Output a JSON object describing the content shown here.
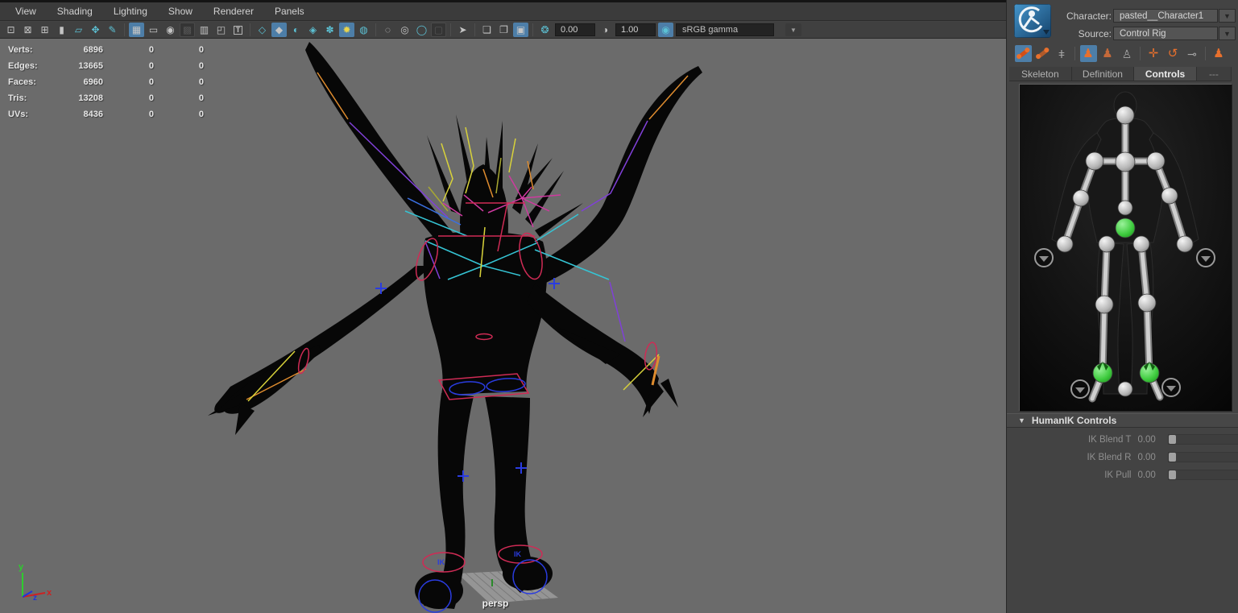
{
  "app": {
    "name": "Maya viewport with HumanIK Controls"
  },
  "menu_bar": {
    "items": [
      "View",
      "Shading",
      "Lighting",
      "Show",
      "Renderer",
      "Panels"
    ]
  },
  "toolbar": {
    "items": [
      {
        "kind": "icon",
        "name": "select-camera-icon",
        "glyph": "⊡",
        "tone": "gray"
      },
      {
        "kind": "icon",
        "name": "lock-camera-icon",
        "glyph": "⊠",
        "tone": "gray"
      },
      {
        "kind": "icon",
        "name": "camera-attributes-icon",
        "glyph": "⊞",
        "tone": "gray"
      },
      {
        "kind": "icon",
        "name": "bookmark-icon",
        "glyph": "▮",
        "tone": "gray"
      },
      {
        "kind": "icon",
        "name": "image-plane-icon",
        "glyph": "▱",
        "tone": "teal"
      },
      {
        "kind": "icon",
        "name": "pan-zoom-icon",
        "glyph": "✥",
        "tone": "teal"
      },
      {
        "kind": "icon",
        "name": "grease-pencil-icon",
        "glyph": "✎",
        "tone": "teal"
      },
      {
        "kind": "sep"
      },
      {
        "kind": "icon",
        "name": "grid-icon",
        "glyph": "▦",
        "tone": "gray",
        "active": true
      },
      {
        "kind": "icon",
        "name": "film-gate-icon",
        "glyph": "▭",
        "tone": "gray"
      },
      {
        "kind": "icon",
        "name": "resolution-gate-icon",
        "glyph": "◉",
        "tone": "gray"
      },
      {
        "kind": "icon",
        "name": "gate-mask-icon",
        "glyph": "▩",
        "tone": "dark"
      },
      {
        "kind": "icon",
        "name": "field-chart-icon",
        "glyph": "▥",
        "tone": "gray"
      },
      {
        "kind": "icon",
        "name": "safe-action-icon",
        "glyph": "◰",
        "tone": "gray"
      },
      {
        "kind": "icon",
        "name": "safe-title-icon",
        "glyph": "T",
        "tone": "gray",
        "boxed": true
      },
      {
        "kind": "sep"
      },
      {
        "kind": "icon",
        "name": "wireframe-icon",
        "glyph": "◇",
        "tone": "teal"
      },
      {
        "kind": "icon",
        "name": "smooth-shade-icon",
        "glyph": "◆",
        "tone": "gray",
        "active": true
      },
      {
        "kind": "icon",
        "name": "textured-icon",
        "glyph": "◐",
        "tone": "teal"
      },
      {
        "kind": "icon",
        "name": "use-default-material-icon",
        "glyph": "◈",
        "tone": "teal"
      },
      {
        "kind": "icon",
        "name": "xray-icon",
        "glyph": "✽",
        "tone": "teal"
      },
      {
        "kind": "icon",
        "name": "lighting-icon",
        "glyph": "✹",
        "tone": "yellow",
        "active": true
      },
      {
        "kind": "icon",
        "name": "shadows-icon",
        "glyph": "◍",
        "tone": "teal"
      },
      {
        "kind": "sep"
      },
      {
        "kind": "icon",
        "name": "occlusion-icon",
        "glyph": "◌",
        "tone": "gray"
      },
      {
        "kind": "icon",
        "name": "motion-blur-icon",
        "glyph": "◎",
        "tone": "gray"
      },
      {
        "kind": "icon",
        "name": "antialias-icon",
        "glyph": "◯",
        "tone": "teal"
      },
      {
        "kind": "icon",
        "name": "depth-of-field-icon",
        "glyph": "▢",
        "tone": "dark"
      },
      {
        "kind": "sep"
      },
      {
        "kind": "icon",
        "name": "isolate-select-icon",
        "glyph": "➤",
        "tone": "gray"
      },
      {
        "kind": "sep"
      },
      {
        "kind": "icon",
        "name": "layer-front-icon",
        "glyph": "❏",
        "tone": "gray"
      },
      {
        "kind": "icon",
        "name": "layer-over-icon",
        "glyph": "❐",
        "tone": "gray"
      },
      {
        "kind": "icon",
        "name": "snapshot-icon",
        "glyph": "▣",
        "tone": "gray",
        "active": true
      },
      {
        "kind": "sep"
      },
      {
        "kind": "icon",
        "name": "exposure-icon",
        "glyph": "❂",
        "tone": "teal"
      },
      {
        "kind": "field",
        "name": "exposure-field",
        "value": "0.00"
      },
      {
        "kind": "icon",
        "name": "contrast-icon",
        "glyph": "◑",
        "tone": "gray"
      },
      {
        "kind": "field",
        "name": "gamma-field",
        "value": "1.00"
      },
      {
        "kind": "icon",
        "name": "color-management-icon",
        "glyph": "◉",
        "tone": "teal",
        "active": true
      },
      {
        "kind": "combo",
        "name": "view-transform-combo",
        "value": "sRGB gamma"
      },
      {
        "kind": "combo_arrow",
        "name": "view-transform-arrow",
        "glyph": "▼"
      }
    ]
  },
  "hud": {
    "rows": [
      {
        "label": "Verts:",
        "c1": "6896",
        "c2": "0",
        "c3": "0"
      },
      {
        "label": "Edges:",
        "c1": "13665",
        "c2": "0",
        "c3": "0"
      },
      {
        "label": "Faces:",
        "c1": "6960",
        "c2": "0",
        "c3": "0"
      },
      {
        "label": "Tris:",
        "c1": "13208",
        "c2": "0",
        "c3": "0"
      },
      {
        "label": "UVs:",
        "c1": "8436",
        "c2": "0",
        "c3": "0"
      }
    ]
  },
  "viewport": {
    "camera_label": "persp",
    "ik_label": "IK",
    "axis": {
      "x": "x",
      "y": "y",
      "z": "z"
    }
  },
  "right_panel": {
    "character_label": "Character:",
    "character_value": "pasted__Character1",
    "source_label": "Source:",
    "source_value": "Control Rig",
    "dropdown_arrow": "▼",
    "icon_bar": [
      {
        "kind": "bone",
        "name": "add-joints-icon",
        "active": true
      },
      {
        "kind": "bone",
        "name": "mirror-joints-icon"
      },
      {
        "kind": "icon",
        "name": "skeleton-icon",
        "glyph": "ǂ",
        "tone": "graylight"
      },
      {
        "kind": "sep"
      },
      {
        "kind": "icon",
        "name": "full-body-mode-icon",
        "glyph": "♟",
        "tone": "orange",
        "active": true
      },
      {
        "kind": "icon",
        "name": "body-part-mode-icon",
        "glyph": "♟",
        "tone": "orange2"
      },
      {
        "kind": "icon",
        "name": "selection-mode-icon",
        "glyph": "♙",
        "tone": "graylight"
      },
      {
        "kind": "sep"
      },
      {
        "kind": "icon",
        "name": "pin-translate-icon",
        "glyph": "✛",
        "tone": "orange"
      },
      {
        "kind": "icon",
        "name": "pin-rotate-icon",
        "glyph": "↺",
        "tone": "orange"
      },
      {
        "kind": "icon",
        "name": "pin-off-icon",
        "glyph": "⊸",
        "tone": "graylight"
      },
      {
        "kind": "sep"
      },
      {
        "kind": "icon",
        "name": "stance-pose-icon",
        "glyph": "♟",
        "tone": "orange"
      }
    ],
    "tabs": [
      {
        "label": "Skeleton"
      },
      {
        "label": "Definition"
      },
      {
        "label": "Controls",
        "active": true
      },
      {
        "label": "---",
        "muted": true
      }
    ],
    "humanik_controls": {
      "title": "HumanIK Controls",
      "collapse_arrow": "▼",
      "sliders": [
        {
          "label": "IK Blend T",
          "value": "0.00"
        },
        {
          "label": "IK Blend R",
          "value": "0.00"
        },
        {
          "label": "IK Pull",
          "value": "0.00"
        }
      ]
    }
  },
  "colors": {
    "viewport_bg": "#6b6b6b",
    "panel_bg": "#434343",
    "active_highlight_blue": "#4d7ea8",
    "hik_orange": "#e8702d",
    "joint_green": "#3ecb3e",
    "control_red": "#cf2b55",
    "control_blue": "#2a3ce0",
    "control_cyan": "#35c4d4",
    "control_purple": "#8040d8",
    "control_orange": "#df8c2e",
    "control_yellow": "#d8d23a",
    "control_magenta": "#cf3aa0"
  }
}
